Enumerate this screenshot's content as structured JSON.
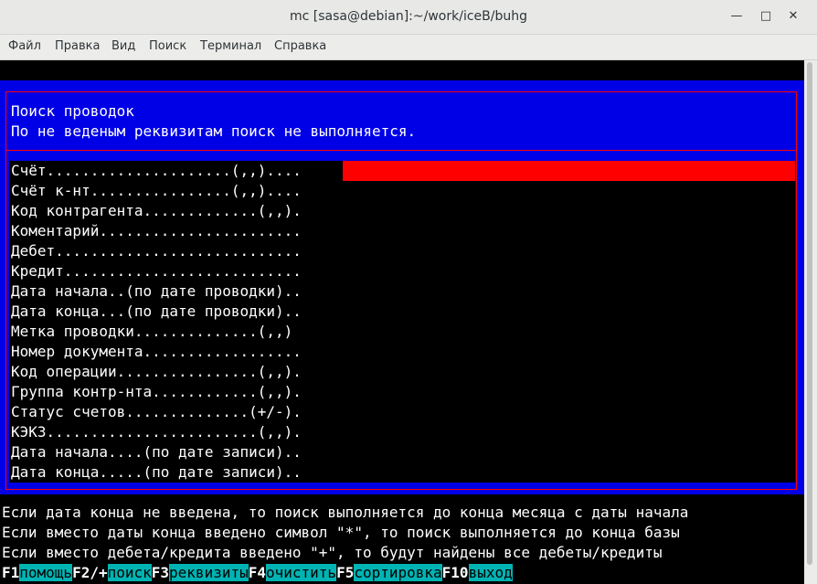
{
  "window": {
    "title": "mc [sasa@debian]:~/work/iceB/buhg"
  },
  "menu": [
    "Файл",
    "Правка",
    "Вид",
    "Поиск",
    "Терминал",
    "Справка"
  ],
  "dialog": {
    "title": "Поиск проводок",
    "subtitle": "По не веденым реквизитам поиск не выполняется.",
    "fields": [
      "Счёт.....................(,,)....",
      "Счёт к-нт................(,,)....",
      "Код контрагента.............(,,).",
      "Коментарий.......................",
      "Дебет............................",
      "Кредит...........................",
      "Дата начала..(по дате проводки)..",
      "Дата конца...(по дате проводки)..",
      "Метка проводки..............(,,)",
      "Номер документа..................",
      "Код операции................(,,).",
      "Группа контр-нта............(,,).",
      "Статус счетов..............(+/-).",
      "КЭКЗ........................(,,).",
      "Дата начала....(по дате записи)..",
      "Дата конца.....(по дате записи).."
    ]
  },
  "info": [
    "Если дата конца не введена, то поиск выполняется до конца месяца с даты начала",
    "Если вместо даты конца введено символ \"*\", то поиск выполняется до конца базы",
    "Если вместо дебета/кредита введено \"+\", то будут найдены все дебеты/кредиты"
  ],
  "fkeys": [
    {
      "key": "F1",
      "label": "помощь"
    },
    {
      "key": "F2/+",
      "label": "поиск"
    },
    {
      "key": "F3",
      "label": "реквизиты"
    },
    {
      "key": "F4",
      "label": "очистить"
    },
    {
      "key": "F5",
      "label": "сортировка"
    },
    {
      "key": "F10",
      "label": "выход"
    }
  ]
}
